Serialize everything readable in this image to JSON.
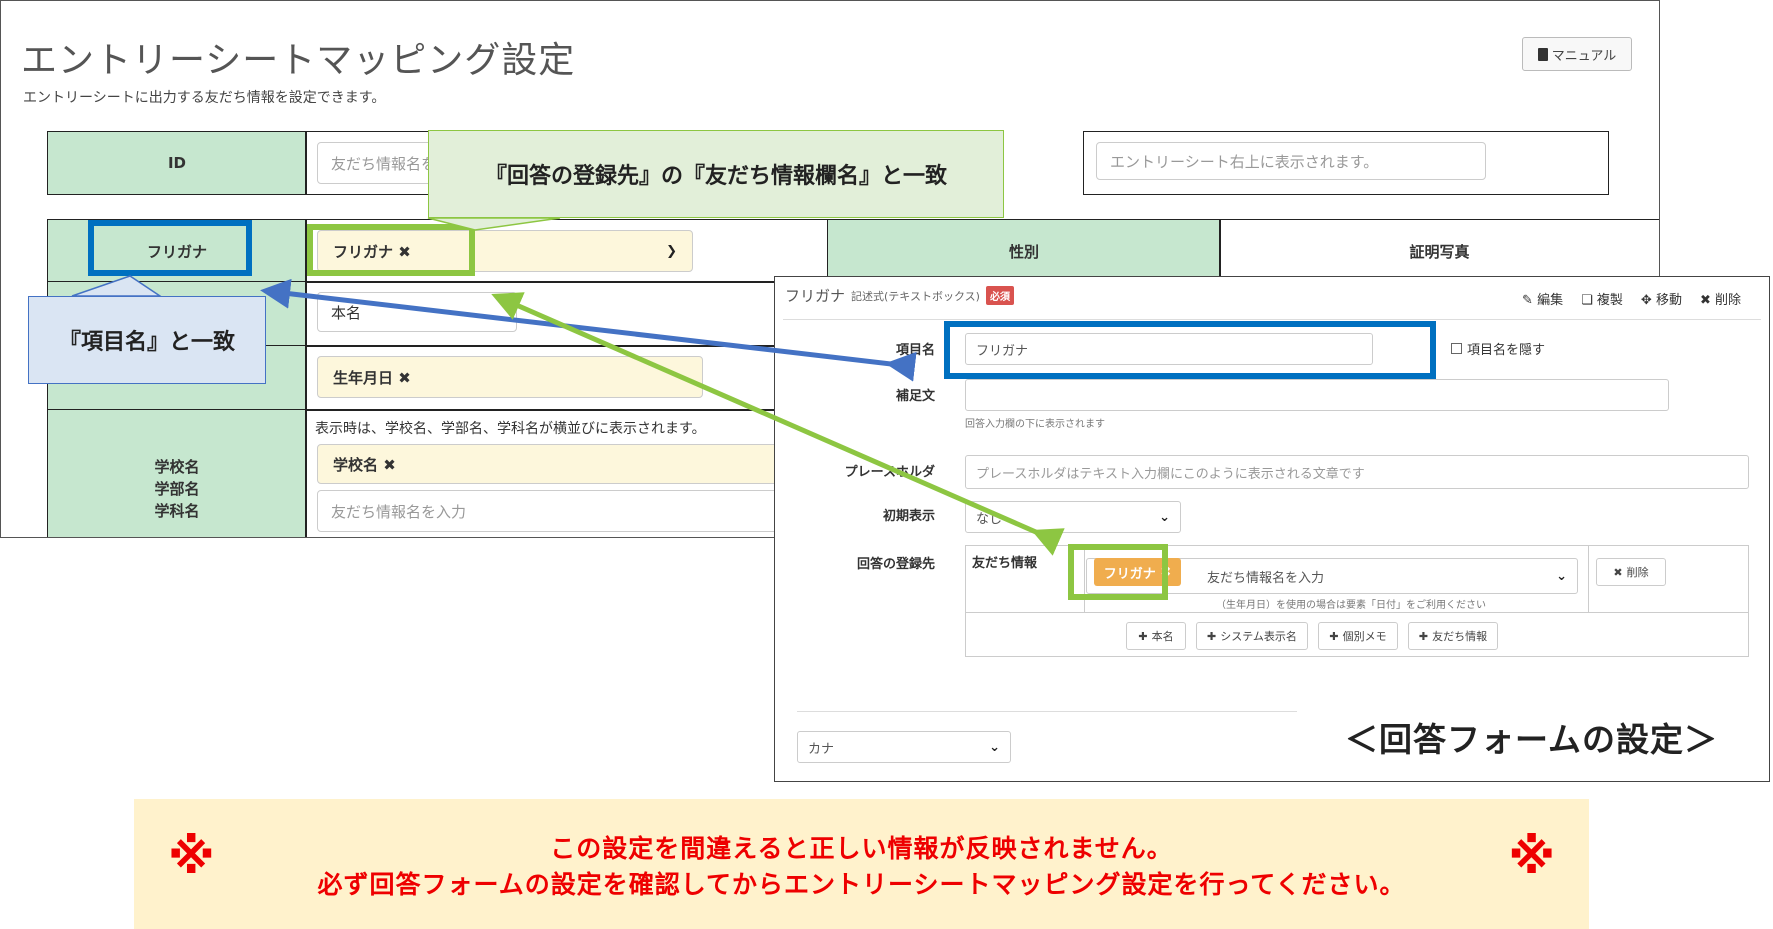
{
  "mapping_screen": {
    "title": "エントリーシートマッピング設定",
    "description": "エントリーシートに出力する友だち情報を設定できます。",
    "manual_label": "マニュアル",
    "id_label": "ID",
    "id_placeholder": "友だち情報名を",
    "entry_placeholder": "エントリーシート右上に表示されます。",
    "furigana_label": "フリガナ",
    "furigana_tag": "フリガナ",
    "honmyo_value": "本名",
    "birthdate_tag": "生年月日",
    "gender_label": "性別",
    "photo_label": "証明写真",
    "school_label_1": "学校名",
    "school_label_2": "学部名",
    "school_label_3": "学科名",
    "school_note": "表示時は、学校名、学部名、学科名が横並びに表示されます。",
    "school_tag": "学校名",
    "friend_placeholder": "友だち情報名を入力",
    "remove_mark": "✖"
  },
  "callouts": {
    "top": "『回答の登録先』の『友だち情報欄名』と一致",
    "left": "『項目名』と一致"
  },
  "form_panel": {
    "item_title": "フリガナ",
    "item_type": "記述式(テキストボックス)",
    "required_badge": "必須",
    "edit_label": "編集",
    "copy_label": "複製",
    "move_label": "移動",
    "delete_label": "削除",
    "field_name_label": "項目名",
    "field_name_value": "フリガナ",
    "hide_name_label": "項目名を隠す",
    "supplement_label": "補足文",
    "supplement_note": "回答入力欄の下に表示されます",
    "placeholder_label": "プレースホルダ",
    "placeholder_value": "プレースホルダはテキスト入力欄にこのように表示される文章です",
    "initial_label": "初期表示",
    "initial_value": "なし",
    "dest_label": "回答の登録先",
    "friend_info_label": "友だち情報",
    "tag_label": "フリガナ",
    "friend_placeholder": "友だち情報名を入力",
    "date_note": "（生年月日）を使用の場合は要素「日付」をご利用ください",
    "row_delete_label": "削除",
    "btn_honmyo": "本名",
    "btn_system_name": "システム表示名",
    "btn_memo": "個別メモ",
    "btn_friend_info": "友だち情報",
    "kana_value": "カナ",
    "caption": "＜回答フォームの設定＞"
  },
  "warning": {
    "mark": "※",
    "line1": "この設定を間違えると正しい情報が反映されません。",
    "line2": "必ず回答フォームの設定を確認してからエントリーシートマッピング設定を行ってください。"
  },
  "colors": {
    "green_header": "#c6e7cf",
    "highlight_blue": "#0070c0",
    "highlight_green": "#8dc642",
    "arrow_blue": "#4472c4",
    "warning_bg": "#fff2cc",
    "warning_text": "#e00000",
    "tag_orange": "#f0ad4e"
  }
}
